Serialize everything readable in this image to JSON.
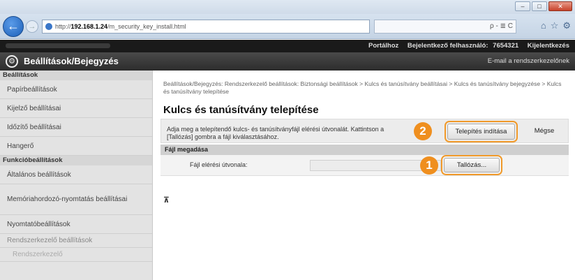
{
  "browser": {
    "url_prefix": "http://",
    "url_host": "192.168.1.24",
    "url_path": "/m_security_key_install.html",
    "search": "ρ - ≣ C",
    "nav_icons": [
      "home-icon",
      "star-icon",
      "settings-icon"
    ],
    "window_controls": [
      "–",
      "□",
      "✕"
    ]
  },
  "topbar": {
    "portal": "Portálhoz",
    "login_user_label": "Bejelentkező felhasználó:",
    "login_user_id": "7654321",
    "logout": "Kijelentkezés"
  },
  "app": {
    "title": "Beállítások/Bejegyzés",
    "email_admin": "E-mail a rendszerkezelőnek"
  },
  "sidebar": {
    "section_settings": "Beállítások",
    "items_settings": [
      "Papírbeállítások",
      "Kijelző beállításai",
      "Időzítő beállításai",
      "Hangerő"
    ],
    "section_functions": "Funkcióbeállítások",
    "items_functions": [
      "Általános beállítások",
      "Memóriahordozó-nyomtatás beállításai",
      "Nyomtatóbeállítások"
    ],
    "section_admin": "Rendszerkezelő beállítások",
    "item_admin": "Rendszerkezelő"
  },
  "main": {
    "breadcrumb": "Beállítások/Bejegyzés: Rendszerkezelő beállítások: Biztonsági beállítások > Kulcs és tanúsítvány beállításai > Kulcs és tanúsítvány bejegyzése > Kulcs és tanúsítvány telepítése",
    "title": "Kulcs és tanúsítvány telepítése",
    "instructions": "Adja meg a telepítendő kulcs- és tanúsítványfájl elérési útvonalát. Kattintson a [Tallózás] gombra a fájl kiválasztásához.",
    "install_button": "Telepítés indítása",
    "cancel_button": "Mégse",
    "file_section_title": "Fájl megadása",
    "file_path_label": "Fájl elérési útvonala:",
    "file_path_value": "",
    "browse_button": "Tallózás...",
    "badge_1": "1",
    "badge_2": "2",
    "to_top": "⊼"
  },
  "colors": {
    "accent_orange": "#ef8f1f",
    "header_dark": "#1a1a1a"
  }
}
